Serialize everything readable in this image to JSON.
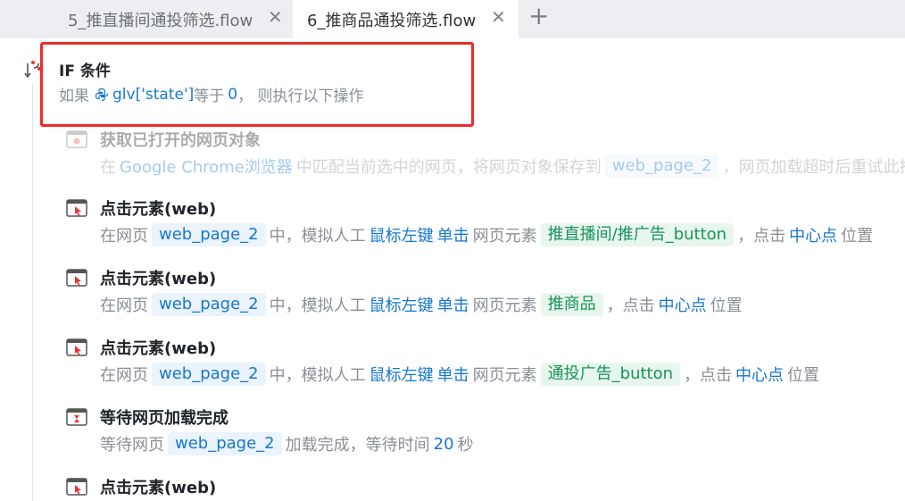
{
  "tabs": [
    {
      "label": "5_推直播间通投筛选.flow",
      "close": "✕"
    },
    {
      "label": "6_推商品通投筛选.flow",
      "close": "✕"
    }
  ],
  "add_tab": "+",
  "if_block": {
    "title": "IF 条件",
    "desc_prefix": "如果",
    "variable": "glv['state']",
    "operator": "等于",
    "value": "0",
    "desc_suffix": "， 则执行以下操作"
  },
  "steps": [
    {
      "title": "获取已打开的网页对象",
      "icon": "browser-get-icon",
      "desc": {
        "p1": "在",
        "browser": "Google Chrome浏览器",
        "p2": "中匹配当前选中的网页，将网页对象保存到",
        "var": "web_page_2",
        "p3": "，网页加载超时后重试此指"
      }
    },
    {
      "title": "点击元素(web)",
      "icon": "web-click-icon",
      "desc": {
        "p1": "在网页",
        "var": "web_page_2",
        "p2": "中，模拟人工",
        "button": "鼠标左键",
        "action": "单击",
        "p3": "网页元素",
        "element": "推直播间/推广告_button",
        "p4": "，点击",
        "pos": "中心点",
        "p5": "位置"
      }
    },
    {
      "title": "点击元素(web)",
      "icon": "web-click-icon",
      "desc": {
        "p1": "在网页",
        "var": "web_page_2",
        "p2": "中，模拟人工",
        "button": "鼠标左键",
        "action": "单击",
        "p3": "网页元素",
        "element": "推商品",
        "p4": "，点击",
        "pos": "中心点",
        "p5": "位置"
      }
    },
    {
      "title": "点击元素(web)",
      "icon": "web-click-icon",
      "desc": {
        "p1": "在网页",
        "var": "web_page_2",
        "p2": "中，模拟人工",
        "button": "鼠标左键",
        "action": "单击",
        "p3": "网页元素",
        "element": "通投广告_button",
        "p4": "，点击",
        "pos": "中心点",
        "p5": "位置"
      }
    },
    {
      "title": "等待网页加载完成",
      "icon": "web-wait-icon",
      "desc": {
        "p1": "等待网页",
        "var": "web_page_2",
        "p2": "加载完成，等待时间",
        "seconds": "20",
        "p3": "秒"
      }
    },
    {
      "title": "点击元素(web)",
      "icon": "web-click-icon"
    }
  ],
  "colors": {
    "accent_blue": "#1677d2",
    "element_green": "#17935a",
    "highlight_red": "#ee2b2b"
  }
}
